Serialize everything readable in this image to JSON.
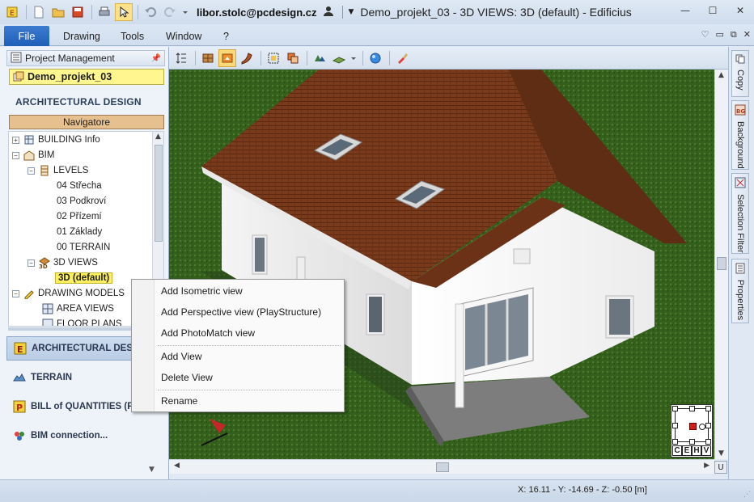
{
  "titlebar": {
    "user": "libor.stolc@pcdesign.cz",
    "title": "Demo_projekt_03 -  3D VIEWS: 3D (default) - Edificius"
  },
  "menubar": {
    "file": "File",
    "items": [
      "Drawing",
      "Tools",
      "Window",
      "?"
    ]
  },
  "project_management": {
    "header": "Project Management",
    "project_name": "Demo_projekt_03",
    "section_title": "ARCHITECTURAL DESIGN",
    "navigator_button": "Navigatore"
  },
  "tree": {
    "items": [
      {
        "label": "BUILDING Info",
        "level": 0,
        "expander": "+"
      },
      {
        "label": "BIM",
        "level": 0,
        "expander": "−"
      },
      {
        "label": "LEVELS",
        "level": 1,
        "expander": "−"
      },
      {
        "label": "04 Střecha",
        "level": 2,
        "expander": ""
      },
      {
        "label": "03 Podkroví",
        "level": 2,
        "expander": ""
      },
      {
        "label": "02 Přízemí",
        "level": 2,
        "expander": ""
      },
      {
        "label": "01 Základy",
        "level": 2,
        "expander": ""
      },
      {
        "label": "00 TERRAIN",
        "level": 2,
        "expander": ""
      },
      {
        "label": "3D VIEWS",
        "level": 1,
        "expander": "−"
      },
      {
        "label": "3D (default)",
        "level": 2,
        "expander": "",
        "selected": true
      },
      {
        "label": "DRAWING MODELS",
        "level": 0,
        "expander": "−"
      },
      {
        "label": "AREA VIEWS",
        "level": 1,
        "expander": ""
      },
      {
        "label": "FLOOR PLANS",
        "level": 1,
        "expander": ""
      }
    ]
  },
  "modules": [
    {
      "label": "ARCHITECTURAL DESIGN",
      "active": true
    },
    {
      "label": "TERRAIN",
      "active": false
    },
    {
      "label": "BILL of QUANTITIES (P...",
      "active": false
    },
    {
      "label": "BIM connection...",
      "active": false
    }
  ],
  "context_menu": {
    "items": [
      "Add Isometric view",
      "Add Perspective view (PlayStructure)",
      "Add PhotoMatch view",
      "Add View",
      "Delete View",
      "Rename"
    ]
  },
  "right_tabs": [
    "Copy",
    "Background",
    "Selection Filter",
    "Properties"
  ],
  "view_cube": {
    "letters": [
      "C",
      "E",
      "H",
      "V"
    ]
  },
  "status": {
    "coords": "X: 16.11 - Y: -14.69 - Z: -0.50 [m]"
  },
  "scroll_button": "U",
  "colors": {
    "accent": "#1f5fb8",
    "selection": "#fff05f",
    "navigator": "#e7c08f",
    "cube_center": "#d31a1a"
  }
}
